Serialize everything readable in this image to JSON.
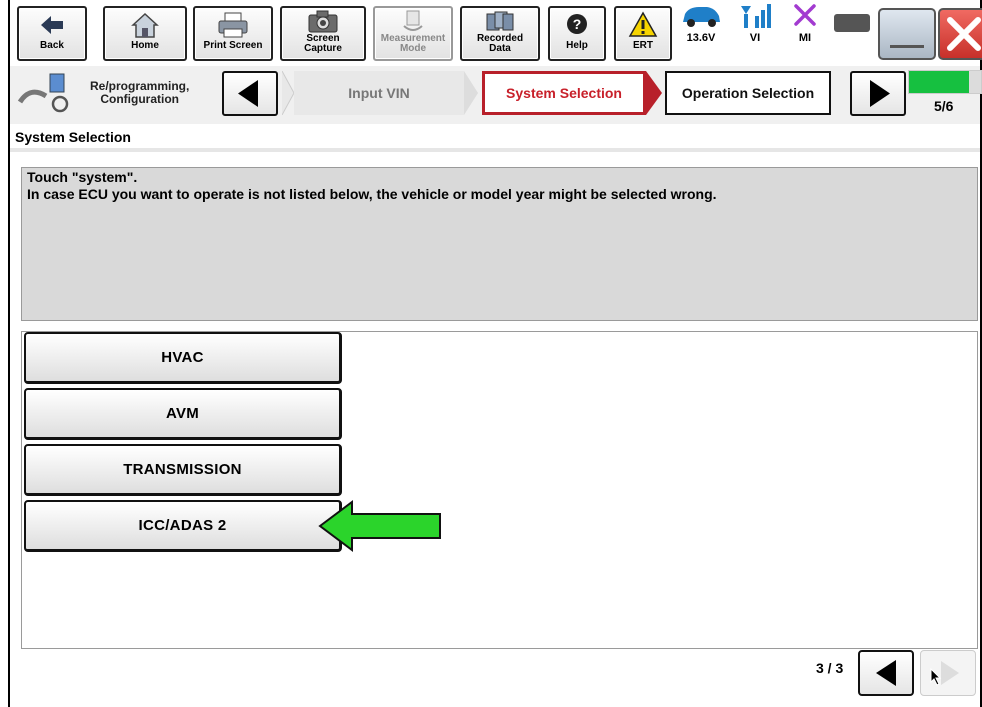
{
  "toolbar": {
    "back": "Back",
    "home": "Home",
    "print_screen": "Print Screen",
    "screen_capture": [
      "Screen",
      "Capture"
    ],
    "measurement_mode": [
      "Measurement",
      "Mode"
    ],
    "recorded_data": [
      "Recorded",
      "Data"
    ],
    "help": "Help",
    "ert": "ERT",
    "voltage": "13.6V",
    "vi": "VI",
    "mi": "MI"
  },
  "breadcrumb": {
    "title": [
      "Re/programming,",
      "Configuration"
    ],
    "steps": [
      {
        "label": "Input VIN",
        "state": "inactive"
      },
      {
        "label": "System Selection",
        "state": "active"
      },
      {
        "label": "Operation Selection",
        "state": "next"
      }
    ],
    "progress_fraction": 0.8333,
    "progress_label": "5/6"
  },
  "section_title": "System Selection",
  "instructions": {
    "line1": "Touch \"system\".",
    "line2": "In case ECU you want to operate is not listed below, the vehicle or model year might be selected wrong."
  },
  "systems": [
    "HVAC",
    "AVM",
    "TRANSMISSION",
    "ICC/ADAS 2"
  ],
  "pager": {
    "label": "3 / 3"
  },
  "colors": {
    "active_step": "#b8202a",
    "progress": "#16c040",
    "annotation_arrow": "#2bd42b"
  }
}
